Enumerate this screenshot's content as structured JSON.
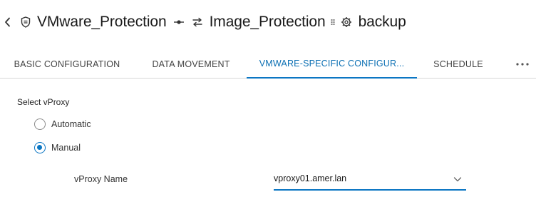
{
  "breadcrumb": {
    "items": [
      {
        "label": "VMware_Protection",
        "icon": "shield-icon"
      },
      {
        "label": "Image_Protection",
        "icon": "arrows-exchange-icon"
      },
      {
        "label": "backup",
        "icon": "gear-icon"
      }
    ]
  },
  "tabs": [
    {
      "label": "BASIC CONFIGURATION",
      "active": false
    },
    {
      "label": "DATA MOVEMENT",
      "active": false
    },
    {
      "label": "VMWARE-SPECIFIC CONFIGUR...",
      "active": true
    },
    {
      "label": "SCHEDULE",
      "active": false
    }
  ],
  "colors": {
    "accent": "#0b76c3",
    "text": "#242424",
    "divider": "#d6d6d6"
  },
  "form": {
    "section_title": "Select vProxy",
    "options": [
      {
        "label": "Automatic",
        "checked": false
      },
      {
        "label": "Manual",
        "checked": true
      }
    ],
    "vproxy_name_label": "vProxy Name",
    "vproxy_name_value": "vproxy01.amer.lan"
  }
}
